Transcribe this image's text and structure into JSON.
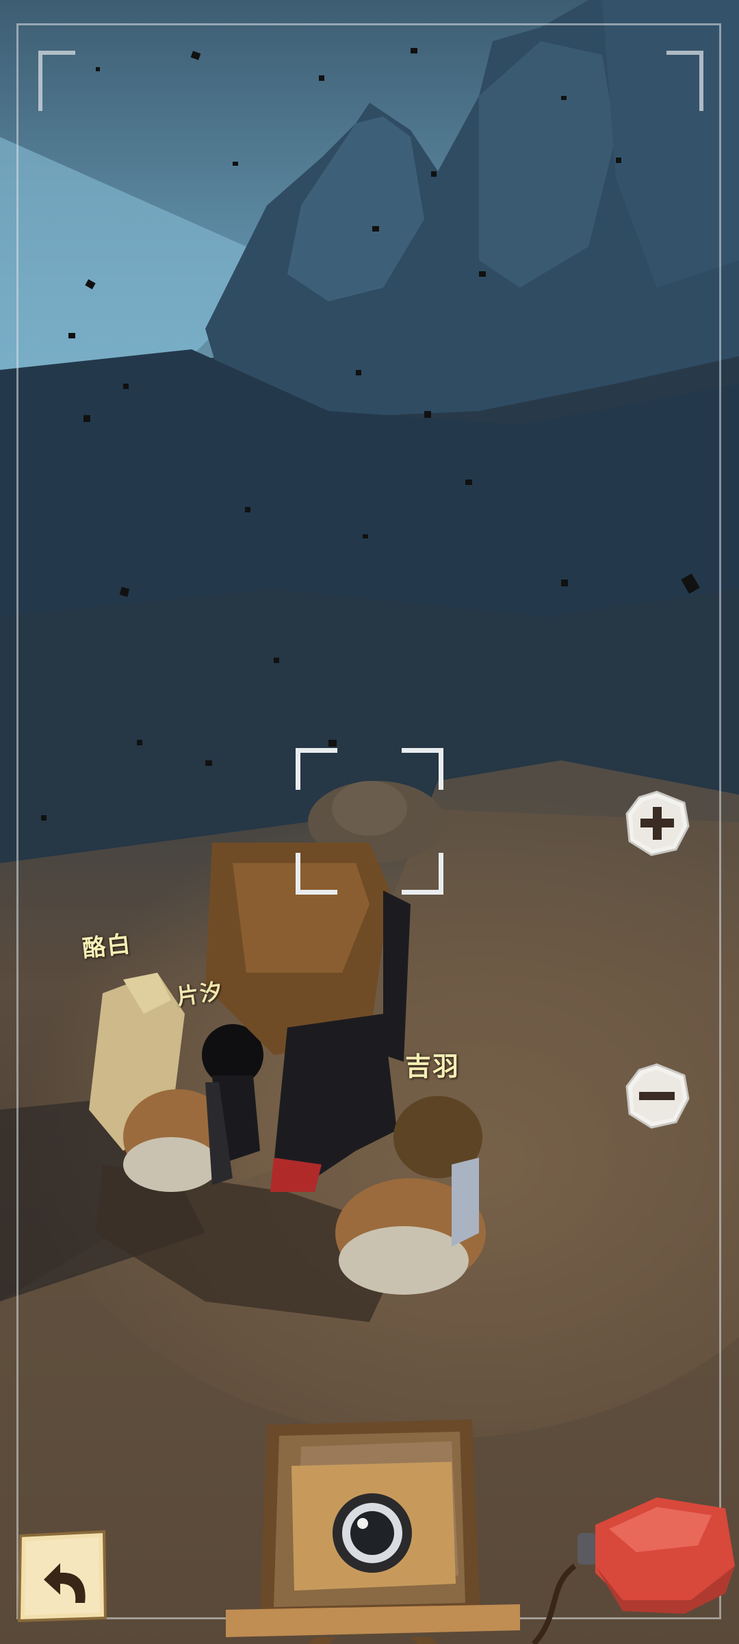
{
  "characters": [
    {
      "name": "酪白"
    },
    {
      "name": "片汐"
    },
    {
      "name": "吉羽"
    }
  ],
  "controls": {
    "zoom_in_icon": "plus-icon",
    "zoom_out_icon": "minus-icon",
    "back_icon": "back-arrow-icon",
    "shutter_icon": "camera-icon",
    "bulb_icon": "shutter-bulb-icon"
  },
  "colors": {
    "name_label": "#f6efb6",
    "sky": "#7fb0c8",
    "ground": "#6e5a44",
    "bulb": "#d8483b"
  }
}
